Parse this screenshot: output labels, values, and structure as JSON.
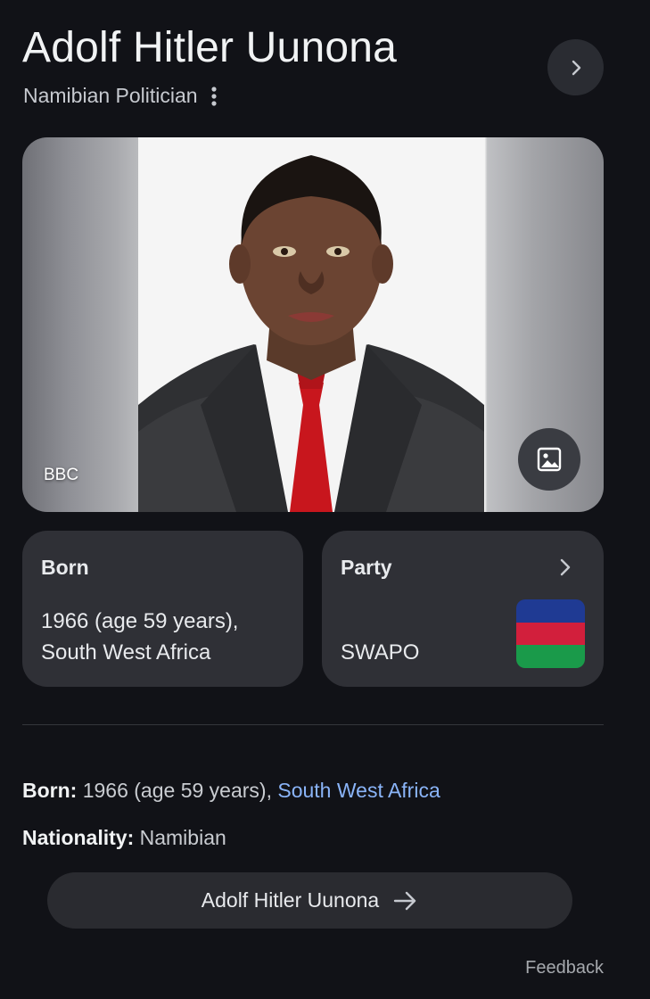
{
  "header": {
    "title": "Adolf Hitler Uunona",
    "subtitle": "Namibian Politician"
  },
  "photo": {
    "credit": "BBC"
  },
  "cards": {
    "born": {
      "heading": "Born",
      "value_line1": "1966 (age 59 years),",
      "value_line2": "South West Africa"
    },
    "party": {
      "heading": "Party",
      "value": "SWAPO",
      "flag_colors": [
        "#1f3a93",
        "#d21f3c",
        "#1a9a4a"
      ]
    }
  },
  "facts": {
    "born_label": "Born:",
    "born_value": " 1966 (age 59 years), ",
    "born_link": "South West Africa",
    "nationality_label": "Nationality:",
    "nationality_value": " Namibian"
  },
  "more_button": {
    "label": "Adolf Hitler Uunona"
  },
  "footer": {
    "feedback": "Feedback"
  },
  "colors": {
    "background": "#111217",
    "card": "#2f3036",
    "link": "#8ab4f8"
  },
  "icons": {
    "next": "chevron-right-icon",
    "menu": "more-vert-icon",
    "photo": "image-icon",
    "arrow": "arrow-right-icon"
  }
}
